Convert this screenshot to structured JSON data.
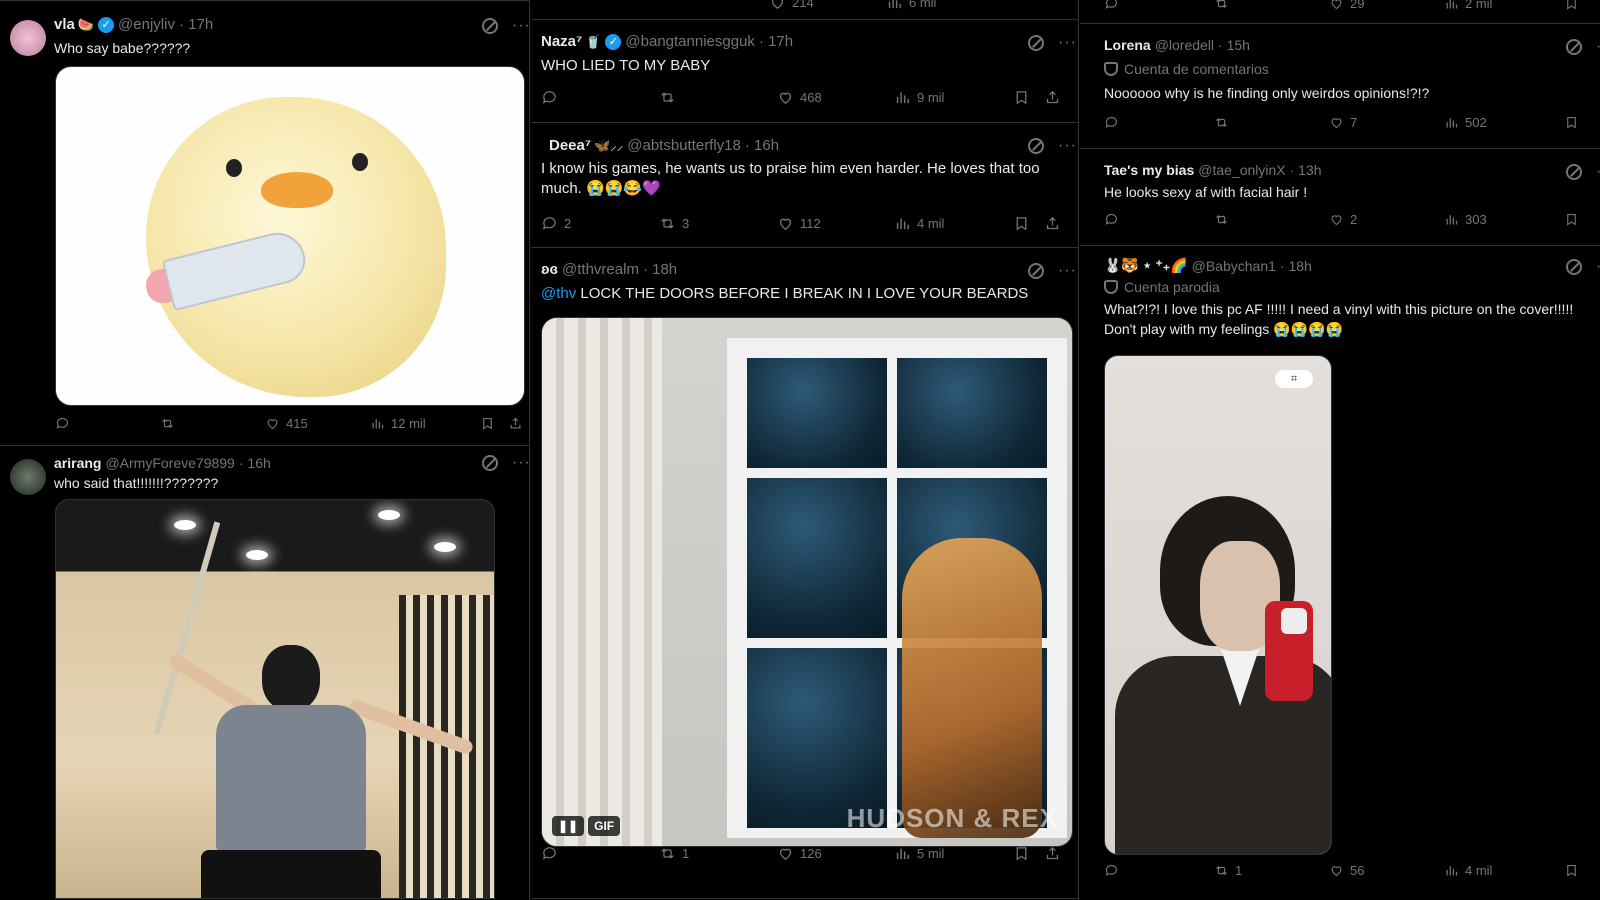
{
  "col1": {
    "post1": {
      "name": "vla",
      "emoji": "🍉",
      "handle": "@enjyliv",
      "time": "· 17h",
      "text": "Who say babe??????",
      "reply": "",
      "repost": "",
      "like": "415",
      "views": "12 mil"
    },
    "post2": {
      "name": "arirang",
      "handle": "@ArmyForeve79899",
      "time": "· 16h",
      "text": "who said that!!!!!!!???????"
    }
  },
  "col2": {
    "prev": {
      "like": "214",
      "views": "6 mil"
    },
    "post1": {
      "name": "Naza⁷",
      "emoji": "🥤",
      "handle": "@bangtanniesgguk",
      "time": "· 17h",
      "text": "WHO LIED TO MY BABY",
      "reply": "",
      "repost": "",
      "like": "468",
      "views": "9 mil"
    },
    "post2": {
      "name": "Deea⁷",
      "emoji": "🦋⸝⸝",
      "handle": "@abtsbutterfly18",
      "time": "· 16h",
      "text": "I know his games, he wants us to praise him even harder. He loves that too much. 😭😭😂💜",
      "reply": "2",
      "repost": "3",
      "like": "112",
      "views": "4 mil"
    },
    "post3": {
      "name": "ʚɞ",
      "handle": "@tthvrealm",
      "time": "· 18h",
      "mention": "@thv",
      "text": " LOCK THE DOORS BEFORE I BREAK IN I LOVE YOUR BEARDS",
      "gif_label": "GIF",
      "watermark": "HUDSON & REX",
      "reply": "",
      "repost": "1",
      "like": "126",
      "views": "5 mil"
    }
  },
  "col3": {
    "prev": {
      "like": "29",
      "views": "2 mil"
    },
    "post1": {
      "name": "Lorena",
      "handle": "@loredell",
      "time": "· 15h",
      "label": "Cuenta de comentarios",
      "text": "Noooooo why is he finding only weirdos opinions!?!?",
      "reply": "",
      "repost": "",
      "like": "7",
      "views": "502"
    },
    "post2": {
      "name": "Tae's my bias",
      "handle": "@tae_onlyinX",
      "time": "· 13h",
      "text": "He looks sexy af with facial hair !",
      "reply": "",
      "repost": "",
      "like": "2",
      "views": "303"
    },
    "post3": {
      "name": "🐰🐯 ⋆ ⁺₊🌈",
      "handle": "@Babychan1",
      "time": "· 18h",
      "label": "Cuenta parodia",
      "text": "What?!?! I love this pc AF !!!!! I need a vinyl with this picture on the cover!!!!! Don't play with my feelings 😭😭😭😭",
      "reply": "",
      "repost": "1",
      "like": "56",
      "views": "4 mil"
    }
  },
  "colors": {
    "bg": "#000000",
    "text": "#e7e9ea",
    "muted": "#71767b",
    "accent": "#1d9bf0",
    "border": "#2f3336"
  }
}
